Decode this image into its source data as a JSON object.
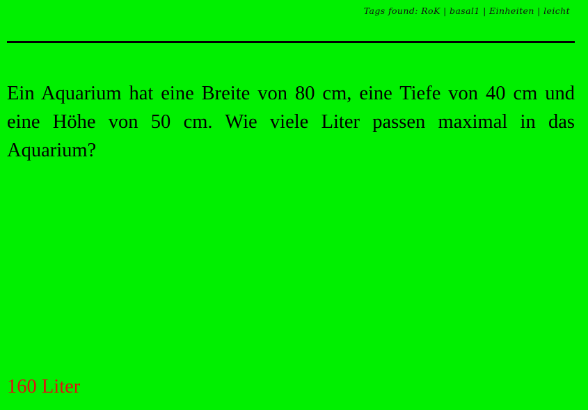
{
  "header": {
    "tags_text": "Tags found: RoK | basal1 | Einheiten | leicht"
  },
  "question": {
    "text": "Ein Aquarium hat eine Breite von 80 cm, eine Tiefe von 40 cm und eine Höhe von 50 cm. Wie viele Liter passen maximal in das Aquarium?"
  },
  "answer": {
    "text": "160 Liter",
    "color": "#e01010"
  },
  "theme": {
    "background": "#00f000"
  }
}
